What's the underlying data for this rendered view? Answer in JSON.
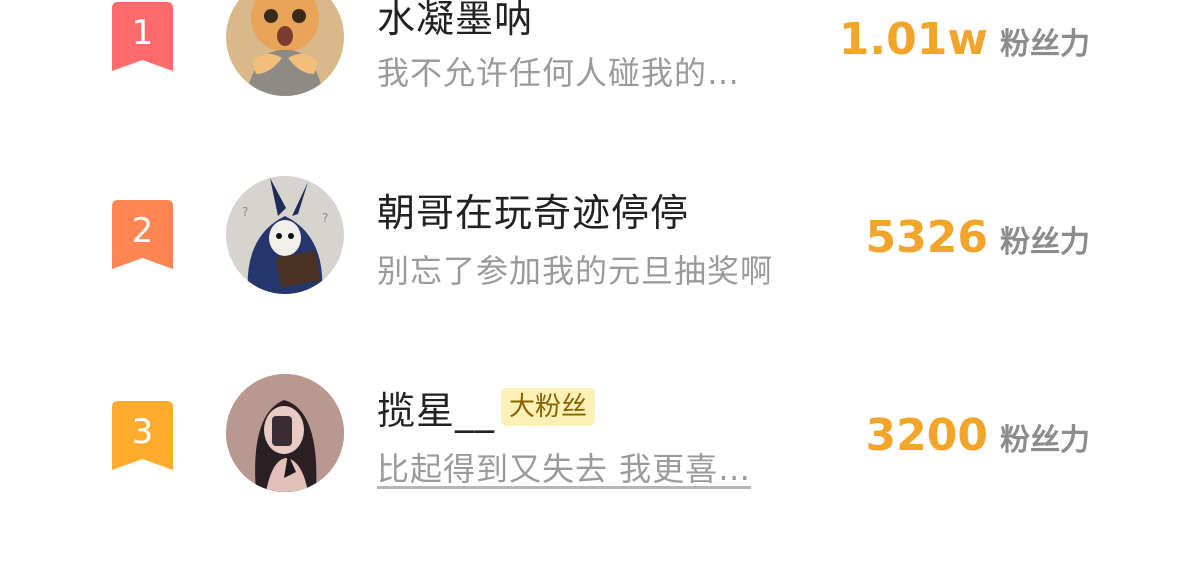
{
  "ranking": {
    "rows": [
      {
        "rank": "1",
        "name": "水凝墨呐",
        "tag": "",
        "description": "我不允许任何人碰我的…",
        "score": "1.01w",
        "score_unit": "粉丝力",
        "badge_color": "#ff6b6b",
        "avatar": "orange-cat-photo"
      },
      {
        "rank": "2",
        "name": "朝哥在玩奇迹停停",
        "tag": "",
        "description": "别忘了参加我的元旦抽奖啊",
        "score": "5326",
        "score_unit": "粉丝力",
        "badge_color": "#ff8552",
        "avatar": "blue-rabbit-reading-illustration"
      },
      {
        "rank": "3",
        "name": "揽星__",
        "tag": "大粉丝",
        "description": "比起得到又失去 我更喜…",
        "score": "3200",
        "score_unit": "粉丝力",
        "badge_color": "#ffab2e",
        "avatar": "girl-mirror-selfie-photo"
      }
    ],
    "colors": {
      "score": "#f2a52a",
      "name": "#222222",
      "description": "#9a9a9a",
      "tag_bg": "#fdf1b8"
    }
  }
}
